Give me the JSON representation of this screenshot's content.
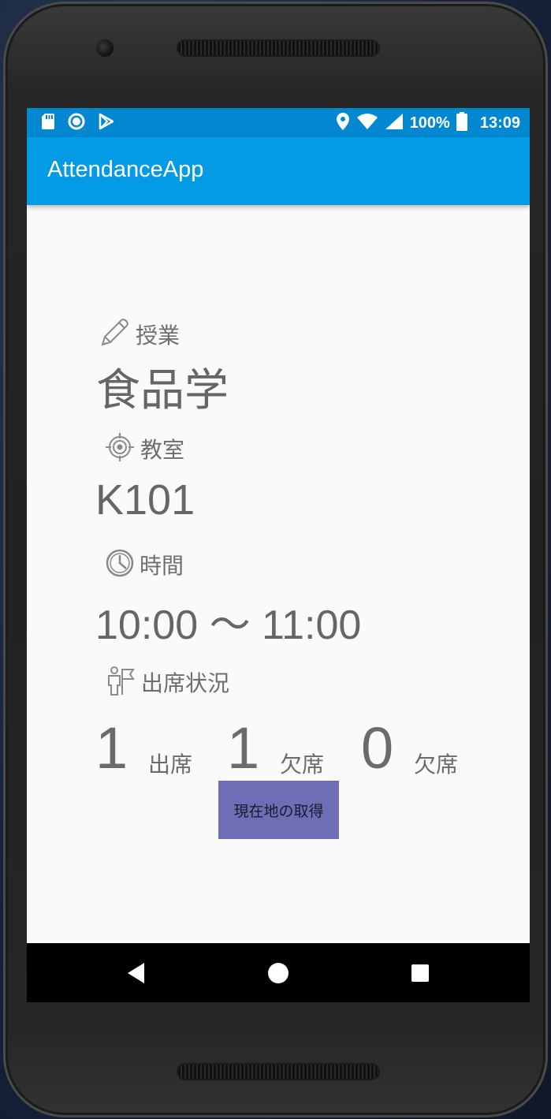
{
  "status_bar": {
    "battery_percent": "100%",
    "time": "13:09",
    "left_icons": [
      "sd-card-icon",
      "sync-circle-icon",
      "play-store-icon"
    ],
    "right_icons": [
      "location-pin-icon",
      "wifi-icon",
      "cell-signal-icon",
      "battery-icon"
    ]
  },
  "app_bar": {
    "title": "AttendanceApp",
    "color": "#039be5"
  },
  "class_section": {
    "label": "授業",
    "icon": "pencil-icon",
    "value": "食品学"
  },
  "room_section": {
    "label": "教室",
    "icon": "target-icon",
    "value": "K101"
  },
  "time_section": {
    "label": "時間",
    "icon": "clock-icon",
    "value": "10:00 〜 11:00"
  },
  "attendance_section": {
    "label": "出席状況",
    "icon": "person-flag-icon",
    "stats": [
      {
        "count": "1",
        "label": "出席"
      },
      {
        "count": "1",
        "label": "欠席"
      },
      {
        "count": "0",
        "label": "欠席"
      }
    ]
  },
  "location_button": {
    "label": "現在地の取得",
    "color": "#6f6db5"
  },
  "nav_bar": {
    "buttons": [
      "back-icon",
      "home-icon",
      "recents-icon"
    ]
  }
}
